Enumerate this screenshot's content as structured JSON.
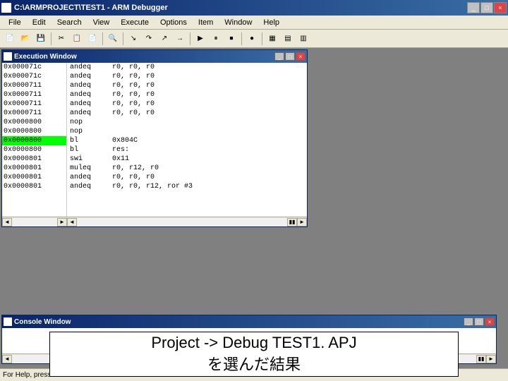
{
  "window": {
    "title": "C:\\ARMPROJECT\\TEST1 - ARM Debugger",
    "controls": {
      "min": "_",
      "max": "□",
      "close": "×"
    }
  },
  "menu": {
    "items": [
      "File",
      "Edit",
      "Search",
      "View",
      "Execute",
      "Options",
      "Item",
      "Window",
      "Help"
    ]
  },
  "toolbar": {
    "icons": [
      "new",
      "open",
      "save",
      "|",
      "cut",
      "copy",
      "paste",
      "|",
      "find",
      "|",
      "step",
      "over",
      "step-out",
      "goto",
      "|",
      "run",
      "pause",
      "stop",
      "|",
      "bp",
      "|",
      "wnd1",
      "wnd2",
      "wnd3"
    ]
  },
  "exec": {
    "title": "Execution Window",
    "rows": [
      {
        "addr": "0x000071c",
        "op": "andeq",
        "args": "r0, r0, r0"
      },
      {
        "addr": "0x000071c",
        "op": "andeq",
        "args": "r0, r0, r0"
      },
      {
        "addr": "0x0000711",
        "op": "andeq",
        "args": "r0, r0, r0"
      },
      {
        "addr": "0x0000711",
        "op": "andeq",
        "args": "r0, r0, r0"
      },
      {
        "addr": "0x0000711",
        "op": "andeq",
        "args": "r0, r0, r0"
      },
      {
        "addr": "0x0000711",
        "op": "andeq",
        "args": "r0, r0, r0"
      },
      {
        "addr": "0x0000800",
        "op": "nop",
        "args": ""
      },
      {
        "addr": "0x0000800",
        "op": "nop",
        "args": ""
      },
      {
        "addr": "0x0000800",
        "op": "bl",
        "args": "0x804C",
        "hl": true
      },
      {
        "addr": "0x0000800",
        "op": "bl",
        "args": "res:"
      },
      {
        "addr": "0x0000801",
        "op": "swi",
        "args": "0x11"
      },
      {
        "addr": "0x0000801",
        "op": "muleq",
        "args": "r0, r12, r0"
      },
      {
        "addr": "0x0000801",
        "op": "andeq",
        "args": "r0, r0, r0"
      },
      {
        "addr": "0x0000801",
        "op": "andeq",
        "args": "r0, r0, r12, ror #3"
      }
    ]
  },
  "console": {
    "title": "Console Window"
  },
  "status": {
    "help": "For Help, press F1"
  },
  "annotation": {
    "line1": "Project -> Debug TEST1. APJ",
    "line2": "を選んだ結果"
  }
}
